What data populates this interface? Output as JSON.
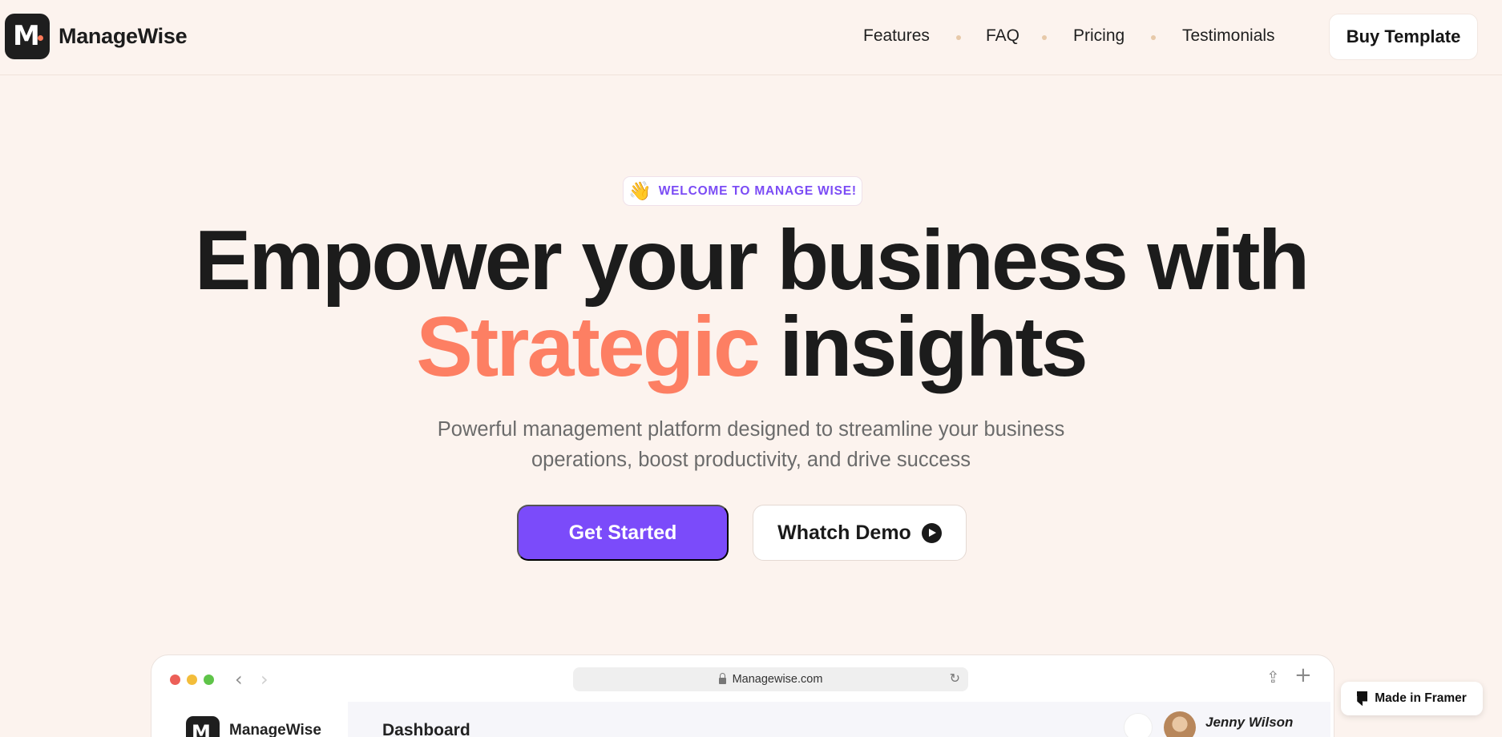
{
  "brand": {
    "name": "ManageWise",
    "logo_letter": "M"
  },
  "nav": {
    "links": [
      "Features",
      "FAQ",
      "Pricing",
      "Testimonials"
    ],
    "cta": "Buy Template"
  },
  "hero": {
    "badge_emoji": "👋",
    "badge_text": "WELCOME TO MANAGE WISE!",
    "headline_line1": "Empower your business with",
    "headline_accent": "Strategic",
    "headline_line2_rest": " insights",
    "subtitle_line1": "Powerful management platform designed to streamline your business",
    "subtitle_line2": "operations, boost productivity, and drive success",
    "primary_button": "Get Started",
    "secondary_button": "Whatch Demo"
  },
  "preview": {
    "url": "Managewise.com",
    "app_brand": "ManageWise",
    "page_title": "Dashboard",
    "user_name": "Jenny Wilson"
  },
  "framer_badge": "Made in Framer",
  "colors": {
    "background": "#fcf3ee",
    "accent": "#fd7f63",
    "primary": "#7b4bfa",
    "badge_text": "#7b4cf5"
  },
  "icons": [
    "logo-mark-icon",
    "wave-hand-icon",
    "play-icon",
    "lock-icon",
    "reload-icon",
    "share-icon",
    "plus-icon",
    "bell-icon",
    "framer-icon"
  ]
}
